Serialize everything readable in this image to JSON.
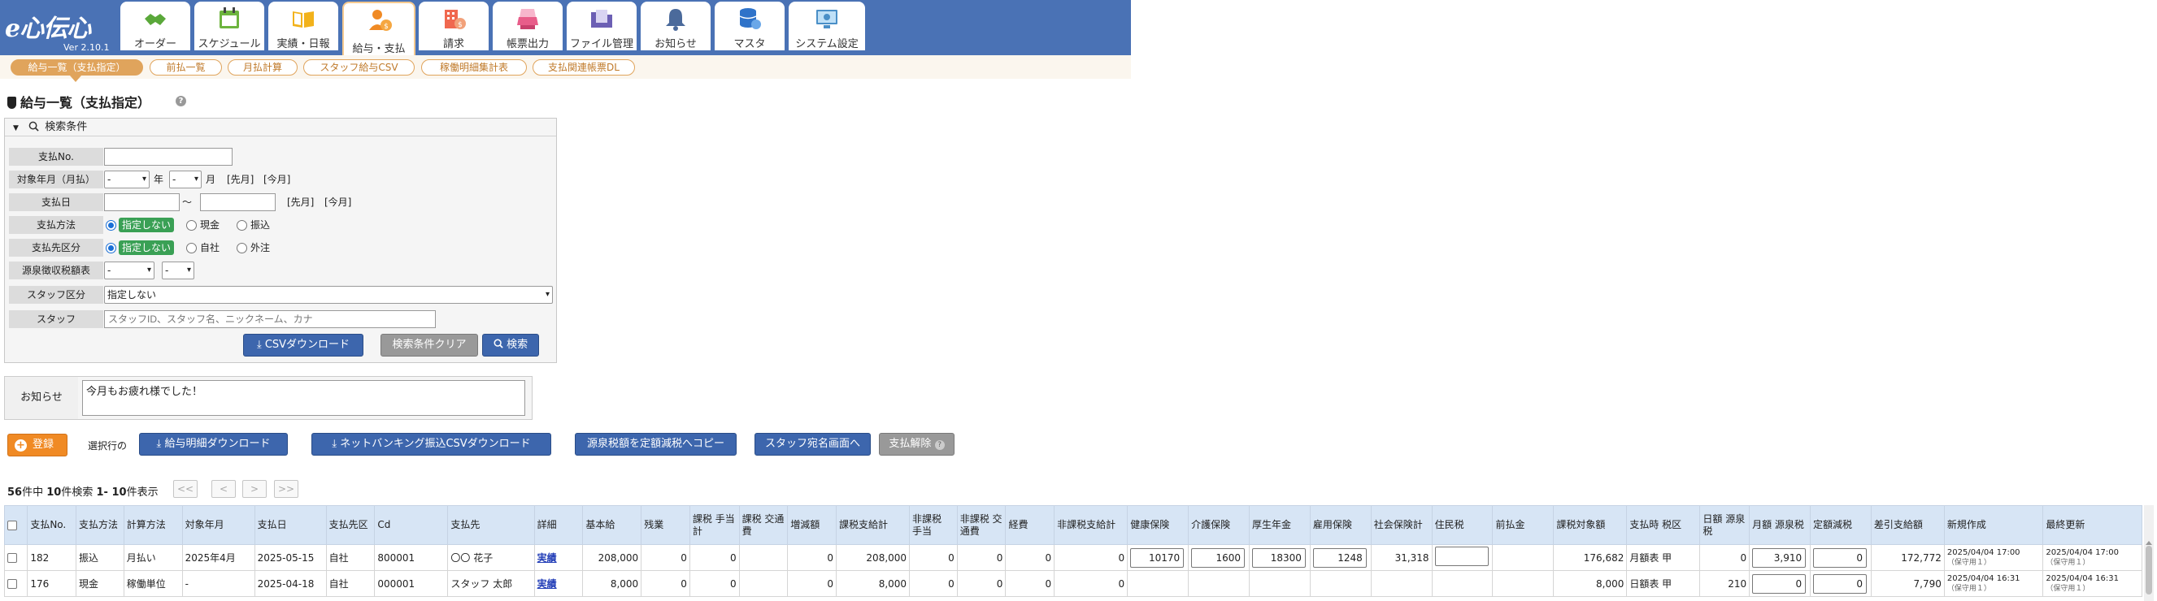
{
  "app": {
    "logo": "e心伝心",
    "version": "Ver 2.10.1"
  },
  "nav": [
    {
      "label": "オーダー",
      "icon": "handshake-icon"
    },
    {
      "label": "スケジュール",
      "icon": "calendar-icon"
    },
    {
      "label": "実績・日報",
      "icon": "book-icon"
    },
    {
      "label": "給与・支払",
      "icon": "person-yen-icon",
      "active": true
    },
    {
      "label": "請求",
      "icon": "building-yen-icon"
    },
    {
      "label": "帳票出力",
      "icon": "printer-icon"
    },
    {
      "label": "ファイル管理",
      "icon": "folder-icon"
    },
    {
      "label": "お知らせ",
      "icon": "bell-icon"
    },
    {
      "label": "マスタ",
      "icon": "database-icon"
    },
    {
      "label": "システム設定",
      "icon": "monitor-gear-icon"
    }
  ],
  "subtabs": [
    {
      "label": "給与一覧（支払指定）",
      "active": true
    },
    {
      "label": "前払一覧"
    },
    {
      "label": "月払計算"
    },
    {
      "label": "スタッフ給与CSV"
    },
    {
      "label": "稼働明細集計表"
    },
    {
      "label": "支払関連帳票DL"
    }
  ],
  "page_title": "給与一覧（支払指定）",
  "search": {
    "header": "検索条件",
    "labels": {
      "pay_no": "支払No.",
      "target_month": "対象年月（月払）",
      "pay_date": "支払日",
      "pay_method": "支払方法",
      "payee_type": "支払先区分",
      "withholding": "源泉徴収税額表",
      "staff_type": "スタッフ区分",
      "staff": "スタッフ"
    },
    "pay_no_value": "",
    "year_value": "-",
    "year_unit": "年",
    "month_value": "-",
    "month_unit": "月",
    "prev_month": "[先月]",
    "this_month": "[今月]",
    "date_tilde": "～",
    "pay_method_options": [
      "指定しない",
      "現金",
      "振込"
    ],
    "payee_options": [
      "指定しない",
      "自社",
      "外注"
    ],
    "withholding_a": "-",
    "withholding_b": "-",
    "staff_type_value": "指定しない",
    "staff_placeholder": "スタッフID、スタッフ名、ニックネーム、カナ",
    "csv_button": "CSVダウンロード",
    "clear_button": "検索条件クリア",
    "search_button": "検索"
  },
  "notice": {
    "label": "お知らせ",
    "text": "今月もお疲れ様でした！"
  },
  "actions": {
    "register": "登録",
    "selected_rows": "選択行の",
    "payslip_dl": "給与明細ダウンロード",
    "netbank_csv": "ネットバンキング振込CSVダウンロード",
    "copy_tax": "源泉税額を定額減税へコピー",
    "staff_address": "スタッフ宛名画面へ",
    "cancel_payment": "支払解除"
  },
  "pager": {
    "total": "56",
    "total_suffix": "件中",
    "found": "10",
    "found_suffix": "件検索",
    "range": "1- 10",
    "range_suffix": "件表示",
    "first": "<<",
    "prev": "<",
    "next": ">",
    "last": ">>"
  },
  "table": {
    "columns": [
      "",
      "支払No.",
      "支払方法",
      "計算方法",
      "対象年月",
      "支払日",
      "支払先区",
      "Cd",
      "支払先",
      "詳細",
      "基本給",
      "残業",
      "課税 手当計",
      "課税 交通費",
      "増減額",
      "課税支給計",
      "非課税 手当",
      "非課税 交通費",
      "経費",
      "非課税支給計",
      "健康保険",
      "介護保険",
      "厚生年金",
      "雇用保険",
      "社会保険計",
      "住民税",
      "前払金",
      "課税対象額",
      "支払時 税区",
      "日額 源泉税",
      "月額 源泉税",
      "定額減税",
      "差引支給額",
      "新規作成",
      "最終更新"
    ],
    "rows": [
      {
        "pay_no": "182",
        "method": "振込",
        "calc": "月払い",
        "month": "2025年4月",
        "date": "2025-05-15",
        "payee_type": "自社",
        "cd": "800001",
        "payee": "〇〇 花子",
        "detail": "実績",
        "base": "208,000",
        "overtime": "0",
        "tax_allow": "0",
        "tax_trans": "",
        "adjust": "0",
        "tax_total": "208,000",
        "nt_allow": "0",
        "nt_trans": "0",
        "expense": "0",
        "nt_total": "0",
        "health": "10170",
        "care": "1600",
        "pension": "18300",
        "employ": "1248",
        "social_total": "31,318",
        "resident": "",
        "advance": "",
        "taxable": "176,682",
        "tax_class": "月額表 甲",
        "daily_tax": "0",
        "monthly_tax": "3,910",
        "fixed_reduction": "0",
        "net_pay": "172,772",
        "created": "2025/04/04 17:00",
        "created_by": "（保守用１）",
        "updated": "2025/04/04 17:00",
        "updated_by": "（保守用１）"
      },
      {
        "pay_no": "176",
        "method": "現金",
        "calc": "稼働単位",
        "month": "-",
        "date": "2025-04-18",
        "payee_type": "自社",
        "cd": "000001",
        "payee": "スタッフ 太郎",
        "detail": "実績",
        "base": "8,000",
        "overtime": "0",
        "tax_allow": "0",
        "tax_trans": "",
        "adjust": "0",
        "tax_total": "8,000",
        "nt_allow": "0",
        "nt_trans": "0",
        "expense": "0",
        "nt_total": "0",
        "health": "",
        "care": "",
        "pension": "",
        "employ": "",
        "social_total": "",
        "resident": "",
        "advance": "",
        "taxable": "8,000",
        "tax_class": "日額表 甲",
        "daily_tax": "210",
        "monthly_tax": "0",
        "fixed_reduction": "0",
        "net_pay": "7,790",
        "created": "2025/04/04 16:31",
        "created_by": "（保守用１）",
        "updated": "2025/04/04 16:31",
        "updated_by": "（保守用１）"
      }
    ]
  },
  "colors": {
    "header_bg": "#4a72b5",
    "accent_orange": "#e0a45c",
    "button_blue": "#3d66ad",
    "tag_green": "#3aa055",
    "table_header": "#d7e5f5"
  }
}
